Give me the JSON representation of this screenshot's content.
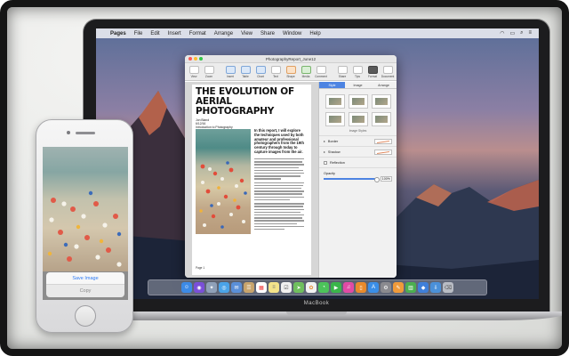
{
  "menubar": {
    "app_name": "Pages",
    "items": [
      "File",
      "Edit",
      "Insert",
      "Format",
      "Arrange",
      "View",
      "Share",
      "Window",
      "Help"
    ]
  },
  "window": {
    "title": "PhotographyReport_June12",
    "toolbar": [
      {
        "label": "View",
        "style": "plain"
      },
      {
        "label": "Zoom",
        "style": "plain"
      },
      {
        "label": "Insert",
        "style": "blue"
      },
      {
        "label": "Table",
        "style": "blue"
      },
      {
        "label": "Chart",
        "style": "blue"
      },
      {
        "label": "Text",
        "style": "plain"
      },
      {
        "label": "Shape",
        "style": "org"
      },
      {
        "label": "Media",
        "style": "grn"
      },
      {
        "label": "Comment",
        "style": "plain"
      },
      {
        "label": "Share",
        "style": "plain"
      },
      {
        "label": "Tips",
        "style": "plain"
      },
      {
        "label": "Format",
        "style": "sel"
      },
      {
        "label": "Document",
        "style": "plain"
      }
    ],
    "zoom": "125%"
  },
  "document": {
    "headline": "THE EVOLUTION OF AERIAL PHOTOGRAPHY",
    "byline": [
      "Jon Bland",
      "6/12/16",
      "Introduction to Photography"
    ],
    "lead": "In this report, I will explore the techniques used by both amateur and professional photographers from the 19th century through today to capture images from the air.",
    "page_label": "Page 1"
  },
  "inspector": {
    "tabs": [
      "Style",
      "Image",
      "Arrange"
    ],
    "active_tab": "Style",
    "styles_caption": "Image Styles",
    "rows": [
      "Border",
      "Shadow",
      "Reflection"
    ],
    "opacity_label": "Opacity",
    "opacity_value": "100%"
  },
  "macbook_label": "MacBook",
  "phone": {
    "save_label": "Save Image",
    "copy_label": "Copy"
  },
  "dock": [
    "finder",
    "siri",
    "launchpad",
    "safari",
    "mail",
    "contacts",
    "calendar",
    "notes",
    "reminders",
    "maps",
    "photos",
    "messages",
    "facetime",
    "itunes",
    "ibooks",
    "appstore",
    "preferences",
    "pages",
    "numbers",
    "keynote",
    "downloads",
    "trash"
  ]
}
